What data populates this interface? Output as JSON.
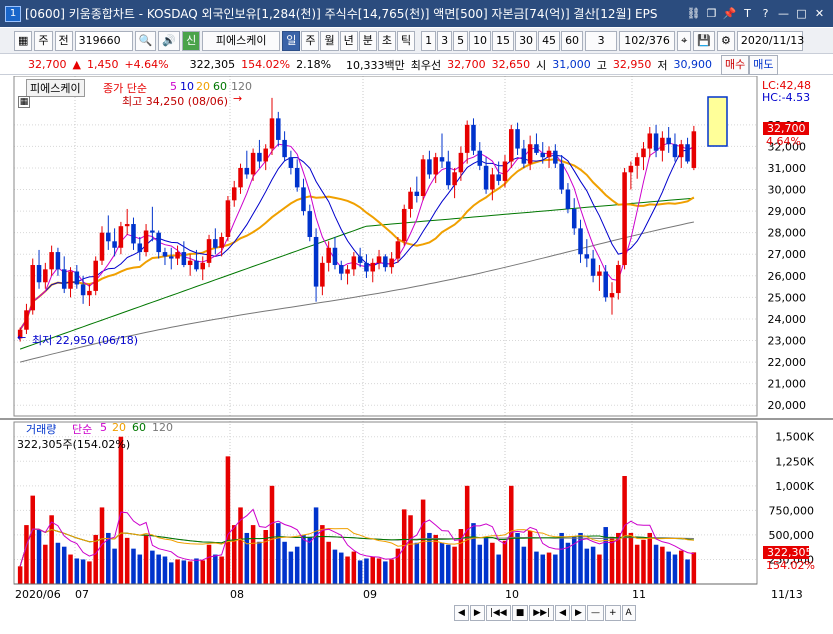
{
  "window": {
    "number": "1",
    "title": "[0600] 키움종합차트 - KOSDAQ 외국인보유[1,284(천)] 주식수[14,765(천)] 액면[500] 자본금[74(억)] 결산[12월] EPS"
  },
  "toolbar": {
    "market": "주",
    "prev": "전",
    "code": "319660",
    "indicator_badge": "신",
    "stock_name": "피에스케이",
    "periods": [
      "일",
      "주",
      "월",
      "년",
      "분",
      "초",
      "틱"
    ],
    "active_period": "일",
    "intervals": [
      "1",
      "3",
      "5",
      "10",
      "15",
      "30",
      "45",
      "60"
    ],
    "interval_value": "3",
    "page_count": "102/376",
    "date": "2020/11/13"
  },
  "infobar": {
    "price": "32,700",
    "change": "1,450",
    "change_pct": "+4.64%",
    "volume": "322,305",
    "volume_ratio": "154.02%",
    "turnover": "2.18%",
    "amount": "10,333백만",
    "best_label": "최우선",
    "best_ask": "32,700",
    "best_bid": "32,650",
    "open_label": "시",
    "open": "31,000",
    "high_label": "고",
    "high": "32,950",
    "low_label": "저",
    "low": "30,900",
    "buy_button": "매수",
    "sell_button": "매도"
  },
  "price_panel": {
    "stock_tag": "피에스케이",
    "legend_main": "종가 단순",
    "ma_periods": [
      "5",
      "10",
      "20",
      "60",
      "120"
    ],
    "ma_colors": [
      "#cc00cc",
      "#0000cc",
      "#f0a000",
      "#007700",
      "#777777"
    ],
    "high_annot": "최고 34,250 (08/06)",
    "low_annot": "최저 22,950 (06/18)",
    "lc": "LC:42,48",
    "hc": "HC:-4.53",
    "last_price_tag": "32,700",
    "last_pct_tag": "4.64%"
  },
  "volume_panel": {
    "legend_main": "거래량",
    "legend_sma": "단순",
    "ma_periods": [
      "5",
      "20",
      "60",
      "120"
    ],
    "current_label": "322,305주(154.02%)",
    "last_volume_tag": "322,305",
    "last_pct_tag": "154.02%"
  },
  "x_axis": {
    "labels": [
      "2020/06",
      "07",
      "08",
      "09",
      "10",
      "11"
    ],
    "right_label": "11/13"
  },
  "scroll_buttons": [
    "◀",
    "▶",
    "|◀◀",
    "■",
    "▶▶|",
    "◀",
    "▶",
    "—",
    "+",
    "A"
  ],
  "chart_data": {
    "type": "candlestick",
    "price_axis_ticks": [
      20000,
      21000,
      22000,
      23000,
      24000,
      25000,
      26000,
      27000,
      28000,
      29000,
      30000,
      31000,
      32000,
      33000
    ],
    "price_ylim": [
      19500,
      34800
    ],
    "volume_axis_ticks": [
      250000,
      500000,
      750000,
      1000000,
      1250000,
      1500000
    ],
    "volume_ylim": [
      0,
      1650000
    ],
    "ohlcv": [
      [
        23100,
        23600,
        22950,
        23500,
        180000,
        "u"
      ],
      [
        23500,
        24700,
        23300,
        24400,
        600000,
        "u"
      ],
      [
        24400,
        26800,
        24200,
        26500,
        900000,
        "u"
      ],
      [
        26500,
        27200,
        25400,
        25700,
        550000,
        "d"
      ],
      [
        25700,
        26600,
        25400,
        26300,
        400000,
        "u"
      ],
      [
        26300,
        27400,
        26000,
        27100,
        700000,
        "u"
      ],
      [
        27100,
        27300,
        26000,
        26300,
        420000,
        "d"
      ],
      [
        26300,
        26900,
        25200,
        25400,
        380000,
        "d"
      ],
      [
        25400,
        26400,
        25000,
        26200,
        300000,
        "u"
      ],
      [
        26200,
        26500,
        25400,
        25600,
        260000,
        "d"
      ],
      [
        25600,
        26000,
        24700,
        25100,
        250000,
        "d"
      ],
      [
        25100,
        25600,
        24600,
        25300,
        230000,
        "u"
      ],
      [
        25300,
        26900,
        25100,
        26700,
        500000,
        "u"
      ],
      [
        26700,
        28300,
        26500,
        28000,
        780000,
        "u"
      ],
      [
        28000,
        28800,
        27200,
        27600,
        520000,
        "d"
      ],
      [
        27600,
        28200,
        26900,
        27300,
        360000,
        "d"
      ],
      [
        27300,
        28500,
        27000,
        28300,
        1500000,
        "u"
      ],
      [
        28300,
        29100,
        27900,
        28400,
        470000,
        "u"
      ],
      [
        28400,
        28700,
        27200,
        27500,
        360000,
        "d"
      ],
      [
        27500,
        27800,
        26700,
        27100,
        300000,
        "d"
      ],
      [
        27100,
        28400,
        26900,
        28100,
        500000,
        "u"
      ],
      [
        28100,
        29200,
        27600,
        28000,
        340000,
        "d"
      ],
      [
        28000,
        28100,
        26800,
        27100,
        300000,
        "d"
      ],
      [
        27100,
        27300,
        26500,
        26900,
        280000,
        "d"
      ],
      [
        26900,
        27300,
        26300,
        26800,
        220000,
        "d"
      ],
      [
        26800,
        27400,
        26500,
        27100,
        250000,
        "u"
      ],
      [
        27100,
        27600,
        26400,
        26500,
        240000,
        "d"
      ],
      [
        26500,
        27000,
        26000,
        26700,
        230000,
        "u"
      ],
      [
        26700,
        27200,
        26200,
        26300,
        260000,
        "d"
      ],
      [
        26300,
        26900,
        25800,
        26600,
        240000,
        "u"
      ],
      [
        26600,
        27900,
        26400,
        27700,
        400000,
        "u"
      ],
      [
        27700,
        28200,
        27000,
        27300,
        300000,
        "d"
      ],
      [
        27300,
        28000,
        26900,
        27800,
        280000,
        "u"
      ],
      [
        27800,
        29700,
        27600,
        29500,
        1300000,
        "u"
      ],
      [
        29500,
        30400,
        29200,
        30100,
        600000,
        "u"
      ],
      [
        30100,
        31200,
        29800,
        31000,
        780000,
        "u"
      ],
      [
        31000,
        31800,
        30500,
        30700,
        520000,
        "d"
      ],
      [
        30700,
        31900,
        30400,
        31700,
        600000,
        "u"
      ],
      [
        31700,
        32300,
        31000,
        31300,
        430000,
        "d"
      ],
      [
        31300,
        32100,
        30900,
        31900,
        550000,
        "u"
      ],
      [
        31900,
        34250,
        31600,
        33300,
        1000000,
        "u"
      ],
      [
        33300,
        33600,
        32000,
        32300,
        620000,
        "d"
      ],
      [
        32300,
        32700,
        31300,
        31500,
        430000,
        "d"
      ],
      [
        31500,
        31800,
        30700,
        31000,
        330000,
        "d"
      ],
      [
        31000,
        31400,
        29900,
        30100,
        380000,
        "d"
      ],
      [
        30100,
        30500,
        28800,
        29000,
        500000,
        "d"
      ],
      [
        29000,
        29300,
        27600,
        27800,
        480000,
        "d"
      ],
      [
        27800,
        28200,
        24800,
        25500,
        780000,
        "d"
      ],
      [
        25500,
        26900,
        25100,
        26600,
        600000,
        "u"
      ],
      [
        26600,
        27600,
        26200,
        27300,
        430000,
        "u"
      ],
      [
        27300,
        27800,
        26300,
        26500,
        350000,
        "d"
      ],
      [
        26500,
        26700,
        25800,
        26100,
        320000,
        "d"
      ],
      [
        26100,
        26500,
        25600,
        26300,
        280000,
        "u"
      ],
      [
        26300,
        27100,
        26000,
        26900,
        330000,
        "u"
      ],
      [
        26900,
        27300,
        26400,
        26600,
        240000,
        "d"
      ],
      [
        26600,
        27000,
        25900,
        26200,
        260000,
        "d"
      ],
      [
        26200,
        26800,
        25700,
        26600,
        280000,
        "u"
      ],
      [
        26600,
        27200,
        26300,
        26900,
        260000,
        "u"
      ],
      [
        26900,
        27000,
        26200,
        26400,
        230000,
        "d"
      ],
      [
        26400,
        27100,
        26100,
        26800,
        250000,
        "u"
      ],
      [
        26800,
        27800,
        26600,
        27600,
        360000,
        "u"
      ],
      [
        27600,
        29300,
        27400,
        29100,
        760000,
        "u"
      ],
      [
        29100,
        30100,
        28700,
        29900,
        700000,
        "u"
      ],
      [
        29900,
        30600,
        29400,
        29700,
        420000,
        "d"
      ],
      [
        29700,
        31600,
        29500,
        31400,
        860000,
        "u"
      ],
      [
        31400,
        31800,
        30500,
        30700,
        520000,
        "d"
      ],
      [
        30700,
        31700,
        30300,
        31500,
        500000,
        "u"
      ],
      [
        31500,
        32600,
        31000,
        31300,
        420000,
        "d"
      ],
      [
        31300,
        31800,
        30000,
        30200,
        400000,
        "d"
      ],
      [
        30200,
        31000,
        29600,
        30800,
        380000,
        "u"
      ],
      [
        30800,
        32000,
        30400,
        31700,
        560000,
        "u"
      ],
      [
        31700,
        33200,
        31200,
        33000,
        1000000,
        "u"
      ],
      [
        33000,
        33300,
        31600,
        31800,
        620000,
        "d"
      ],
      [
        31800,
        32200,
        30900,
        31100,
        400000,
        "d"
      ],
      [
        31100,
        31500,
        29800,
        30000,
        480000,
        "d"
      ],
      [
        30000,
        31000,
        29500,
        30700,
        420000,
        "u"
      ],
      [
        30700,
        31300,
        30200,
        30400,
        300000,
        "d"
      ],
      [
        30400,
        31600,
        30100,
        31300,
        440000,
        "u"
      ],
      [
        31300,
        33000,
        31000,
        32800,
        1000000,
        "u"
      ],
      [
        32800,
        33100,
        31600,
        31900,
        520000,
        "d"
      ],
      [
        31900,
        32300,
        31000,
        31200,
        380000,
        "d"
      ],
      [
        31200,
        32500,
        30900,
        32100,
        540000,
        "u"
      ],
      [
        32100,
        32600,
        31600,
        31700,
        330000,
        "d"
      ],
      [
        31700,
        32200,
        31200,
        31500,
        300000,
        "d"
      ],
      [
        31500,
        32000,
        31000,
        31800,
        320000,
        "u"
      ],
      [
        31800,
        32100,
        31000,
        31200,
        300000,
        "d"
      ],
      [
        31200,
        31600,
        29800,
        30000,
        520000,
        "d"
      ],
      [
        30000,
        30300,
        28900,
        29100,
        420000,
        "d"
      ],
      [
        29100,
        29600,
        27900,
        28200,
        480000,
        "d"
      ],
      [
        28200,
        28600,
        26600,
        27000,
        520000,
        "d"
      ],
      [
        27000,
        27700,
        26400,
        26800,
        360000,
        "d"
      ],
      [
        26800,
        27200,
        25700,
        26000,
        380000,
        "d"
      ],
      [
        26000,
        26500,
        25300,
        26200,
        300000,
        "u"
      ],
      [
        26200,
        26500,
        24800,
        25000,
        580000,
        "d"
      ],
      [
        25000,
        25700,
        24200,
        25200,
        480000,
        "u"
      ],
      [
        25200,
        26700,
        24900,
        26500,
        520000,
        "u"
      ],
      [
        26500,
        31000,
        26300,
        30800,
        1100000,
        "u"
      ],
      [
        30800,
        31300,
        30000,
        31100,
        520000,
        "u"
      ],
      [
        31100,
        31700,
        30500,
        31500,
        400000,
        "u"
      ],
      [
        31500,
        32200,
        30900,
        31900,
        450000,
        "u"
      ],
      [
        31900,
        32900,
        31500,
        32600,
        520000,
        "u"
      ],
      [
        32600,
        33000,
        31500,
        31800,
        400000,
        "d"
      ],
      [
        31800,
        32700,
        31300,
        32400,
        380000,
        "u"
      ],
      [
        32400,
        32900,
        31700,
        32100,
        330000,
        "d"
      ],
      [
        32100,
        32600,
        31300,
        31500,
        300000,
        "d"
      ],
      [
        31500,
        32300,
        31000,
        32100,
        340000,
        "u"
      ],
      [
        32100,
        32400,
        31200,
        31300,
        250000,
        "d"
      ],
      [
        31000,
        32950,
        30900,
        32700,
        322305,
        "u"
      ]
    ]
  }
}
